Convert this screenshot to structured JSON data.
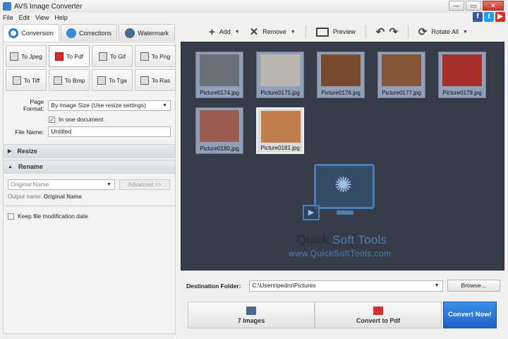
{
  "window": {
    "title": "AVS Image Converter",
    "min": "—",
    "max": "▭",
    "close": "✕"
  },
  "menu": [
    "File",
    "Edit",
    "View",
    "Help"
  ],
  "social": {
    "facebook": "f",
    "twitter": "t",
    "youtube": "▶"
  },
  "tabs": [
    "Conversion",
    "Corrections",
    "Watermark"
  ],
  "toolbar": {
    "add": "Add",
    "remove": "Remove",
    "preview": "Preview",
    "rotate_all": "Rotate All"
  },
  "formats": [
    {
      "label": "To Jpeg"
    },
    {
      "label": "To Pdf",
      "active": true
    },
    {
      "label": "To Gif"
    },
    {
      "label": "To Png"
    },
    {
      "label": "To Tiff"
    },
    {
      "label": "To Bmp"
    },
    {
      "label": "To Tga"
    },
    {
      "label": "To Ras"
    }
  ],
  "settings": {
    "page_format_label": "Page Format:",
    "page_format_value": "By Image Size (Use resize settings)",
    "one_document_label": "In one document",
    "one_document_checked": true,
    "file_name_label": "File Name:",
    "file_name_value": "Untitled"
  },
  "sections": {
    "resize": "Resize",
    "rename": "Rename"
  },
  "rename": {
    "select_value": "Original Name",
    "advanced_button": "Advanced >>",
    "output_label": "Output name:",
    "output_value": "Original Name",
    "keep_date_label": "Keep file modification date"
  },
  "images": [
    {
      "name": "Picture0174.jpg",
      "color": "#6a6e78",
      "selected": false
    },
    {
      "name": "Picture0175.jpg",
      "color": "#b9b7b0",
      "selected": false
    },
    {
      "name": "Picture0176.jpg",
      "color": "#7a4a2c",
      "selected": false
    },
    {
      "name": "Picture0177.jpg",
      "color": "#865436",
      "selected": false
    },
    {
      "name": "Picture0179.jpg",
      "color": "#a8302a",
      "selected": false
    },
    {
      "name": "Picture0180.jpg",
      "color": "#9a5c4e",
      "selected": false
    },
    {
      "name": "Picture0181.jpg",
      "color": "#c07c4a",
      "selected": true
    }
  ],
  "watermark": {
    "name_part1": "Quick ",
    "name_part2": "Soft Tools",
    "url": "www.QuickSoftTools.com"
  },
  "destination": {
    "label": "Destination Folder:",
    "path": "C:\\Users\\pedro\\Pictures",
    "browse": "Browse..."
  },
  "steps": {
    "count": "7 Images",
    "action": "Convert to Pdf",
    "convert_button": "Convert Now!"
  }
}
